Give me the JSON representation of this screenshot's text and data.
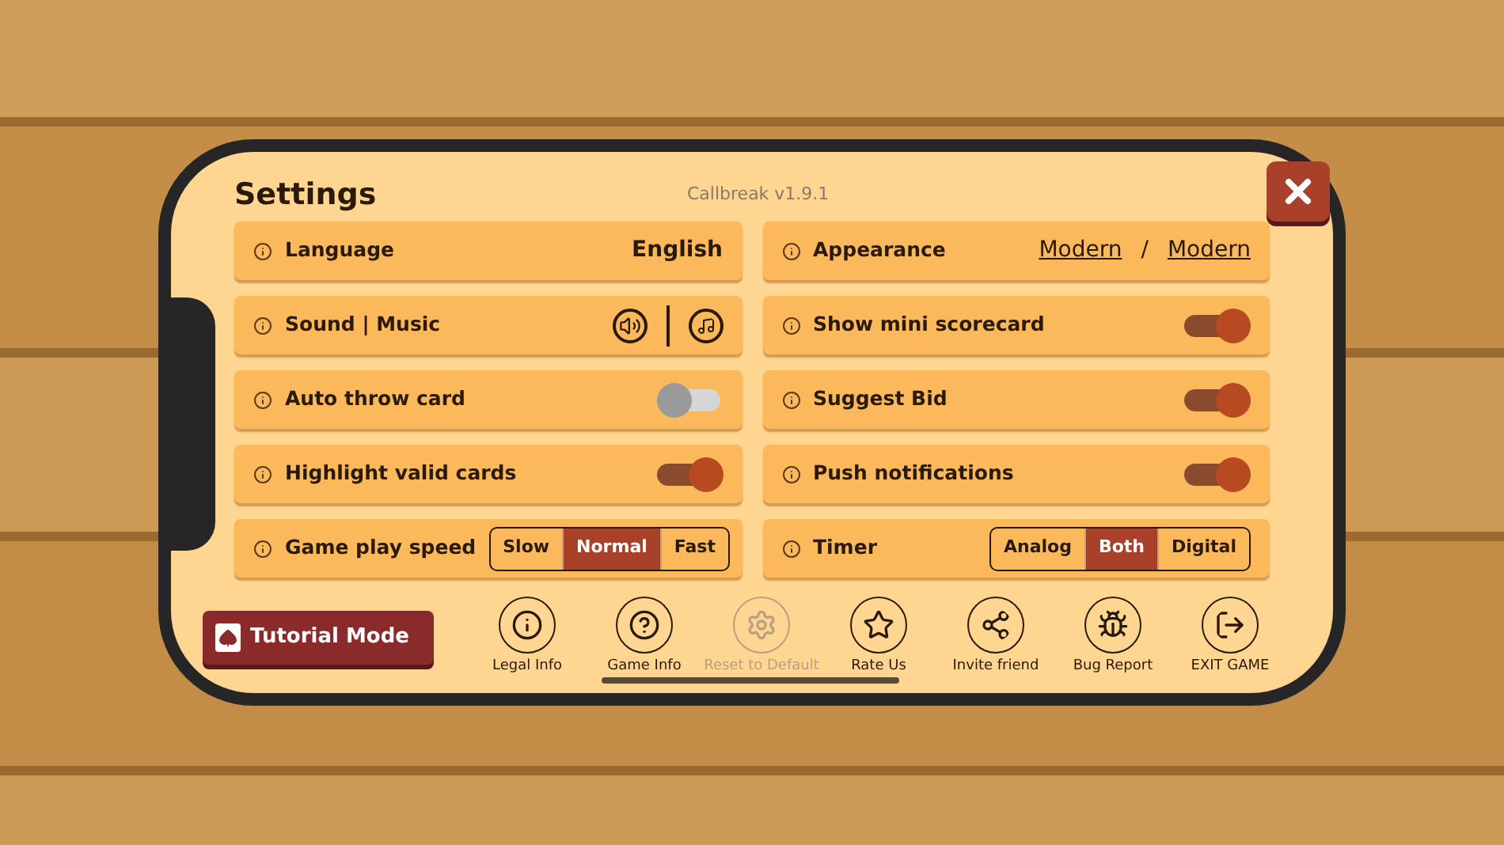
{
  "title": "Settings",
  "version": "Callbreak v1.9.1",
  "left": [
    {
      "kind": "value",
      "label": "Language",
      "value": "English"
    },
    {
      "kind": "sound",
      "label": "Sound | Music"
    },
    {
      "kind": "toggle",
      "label": "Auto throw card",
      "on": false
    },
    {
      "kind": "toggle",
      "label": "Highlight valid cards",
      "on": true
    },
    {
      "kind": "segmented",
      "label": "Game play speed",
      "options": [
        {
          "label": "Slow",
          "selected": false
        },
        {
          "label": "Normal",
          "selected": true
        },
        {
          "label": "Fast",
          "selected": false
        }
      ]
    }
  ],
  "right": [
    {
      "kind": "appearance",
      "label": "Appearance",
      "values": [
        "Modern",
        "/",
        "Modern"
      ]
    },
    {
      "kind": "toggle",
      "label": "Show mini scorecard",
      "on": true
    },
    {
      "kind": "toggle",
      "label": "Suggest Bid",
      "on": true
    },
    {
      "kind": "toggle",
      "label": "Push notifications",
      "on": true
    },
    {
      "kind": "segmented",
      "label": "Timer",
      "options": [
        {
          "label": "Analog",
          "selected": false
        },
        {
          "label": "Both",
          "selected": true
        },
        {
          "label": "Digital",
          "selected": false
        }
      ]
    }
  ],
  "tutorial_button": "Tutorial Mode",
  "actions": [
    {
      "kind": "info",
      "label": "Legal Info",
      "disabled": false
    },
    {
      "kind": "help",
      "label": "Game Info",
      "disabled": false
    },
    {
      "kind": "reset",
      "label": "Reset to Default",
      "disabled": true
    },
    {
      "kind": "rate",
      "label": "Rate Us",
      "disabled": false
    },
    {
      "kind": "share",
      "label": "Invite friend",
      "disabled": false
    },
    {
      "kind": "bug",
      "label": "Bug Report",
      "disabled": false
    },
    {
      "kind": "exit",
      "label": "EXIT GAME",
      "disabled": false
    }
  ]
}
